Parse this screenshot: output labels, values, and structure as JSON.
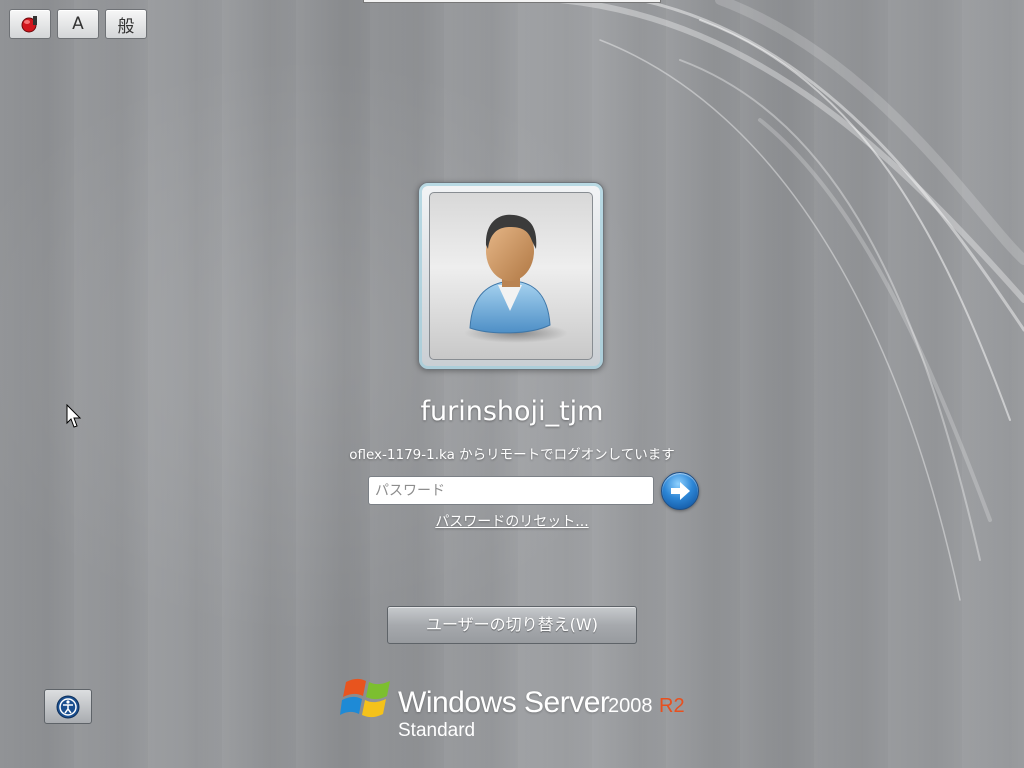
{
  "ime_toolbar": {
    "buttons": [
      {
        "icon": "ime-mode-icon",
        "label": ""
      },
      {
        "icon": "input-mode-icon",
        "label": "A"
      },
      {
        "icon": "conversion-mode-icon",
        "label": "般"
      }
    ]
  },
  "user_tile": {
    "avatar_icon": "default-user-icon",
    "username": "furinshoji_tjm"
  },
  "remote_logon_message": "oflex-1179-1.ka からリモートでログオンしています",
  "password": {
    "value": "",
    "placeholder": "パスワード",
    "submit_icon": "arrow-right-icon"
  },
  "reset_password_link": "パスワードのリセット...",
  "switch_user_button": "ユーザーの切り替え(W)",
  "ease_of_access_icon": "ease-of-access-icon",
  "branding": {
    "logo_icon": "windows-flag-icon",
    "product": "Windows Server",
    "version": "2008",
    "release": "R2",
    "edition": "Standard"
  },
  "colors": {
    "background": "#96989b",
    "go_button": "#2d86d6",
    "r2_accent": "#e8501e",
    "text": "#ffffff"
  }
}
